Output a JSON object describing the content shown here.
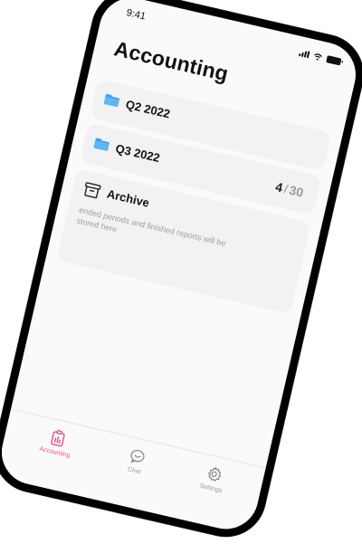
{
  "status_bar": {
    "time": "9:41"
  },
  "header": {
    "title": "Accounting"
  },
  "folders": [
    {
      "label": "Q2 2022"
    },
    {
      "label": "Q3 2022"
    }
  ],
  "counter": {
    "current": "4",
    "separator": "/",
    "total": "30"
  },
  "archive": {
    "label": "Archive",
    "description": "ended periods and finished reports will be stored here"
  },
  "tabs": [
    {
      "label": "Accounting",
      "icon": "clipboard-chart-icon",
      "active": true
    },
    {
      "label": "Chat",
      "icon": "chat-bubble-icon",
      "active": false
    },
    {
      "label": "Settings",
      "icon": "gear-icon",
      "active": false
    }
  ],
  "colors": {
    "accent": "#ec4e87",
    "folder": "#3aa0e8"
  }
}
